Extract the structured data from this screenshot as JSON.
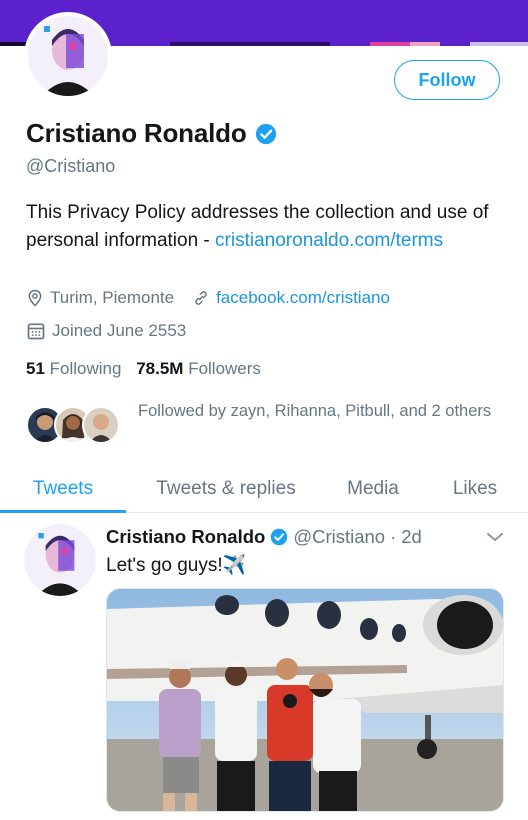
{
  "profile": {
    "name": "Cristiano Ronaldo",
    "handle": "@Cristiano",
    "bio_text": "This Privacy Policy addresses the collection and use of personal information - ",
    "bio_link": "cristianoronaldo.com/terms",
    "location": "Turim, Piemonte",
    "website": "facebook.com/cristiano",
    "joined": "Joined June 2553",
    "following_count": "51",
    "following_label": "Following",
    "followers_count": "78.5M",
    "followers_label": "Followers",
    "followed_by": "Followed by zayn, Rihanna, Pitbull, and 2 others"
  },
  "actions": {
    "follow_label": "Follow"
  },
  "tabs": [
    {
      "label": "Tweets"
    },
    {
      "label": "Tweets & replies"
    },
    {
      "label": "Media"
    },
    {
      "label": "Likes"
    }
  ],
  "tweet": {
    "name": "Cristiano Ronaldo",
    "handle": "@Cristiano",
    "separator": "·",
    "time": "2d",
    "text": "Let's go guys!✈️"
  },
  "colors": {
    "accent": "#1da1f2",
    "banner": "#5b21cc",
    "text_secondary": "#657786"
  }
}
